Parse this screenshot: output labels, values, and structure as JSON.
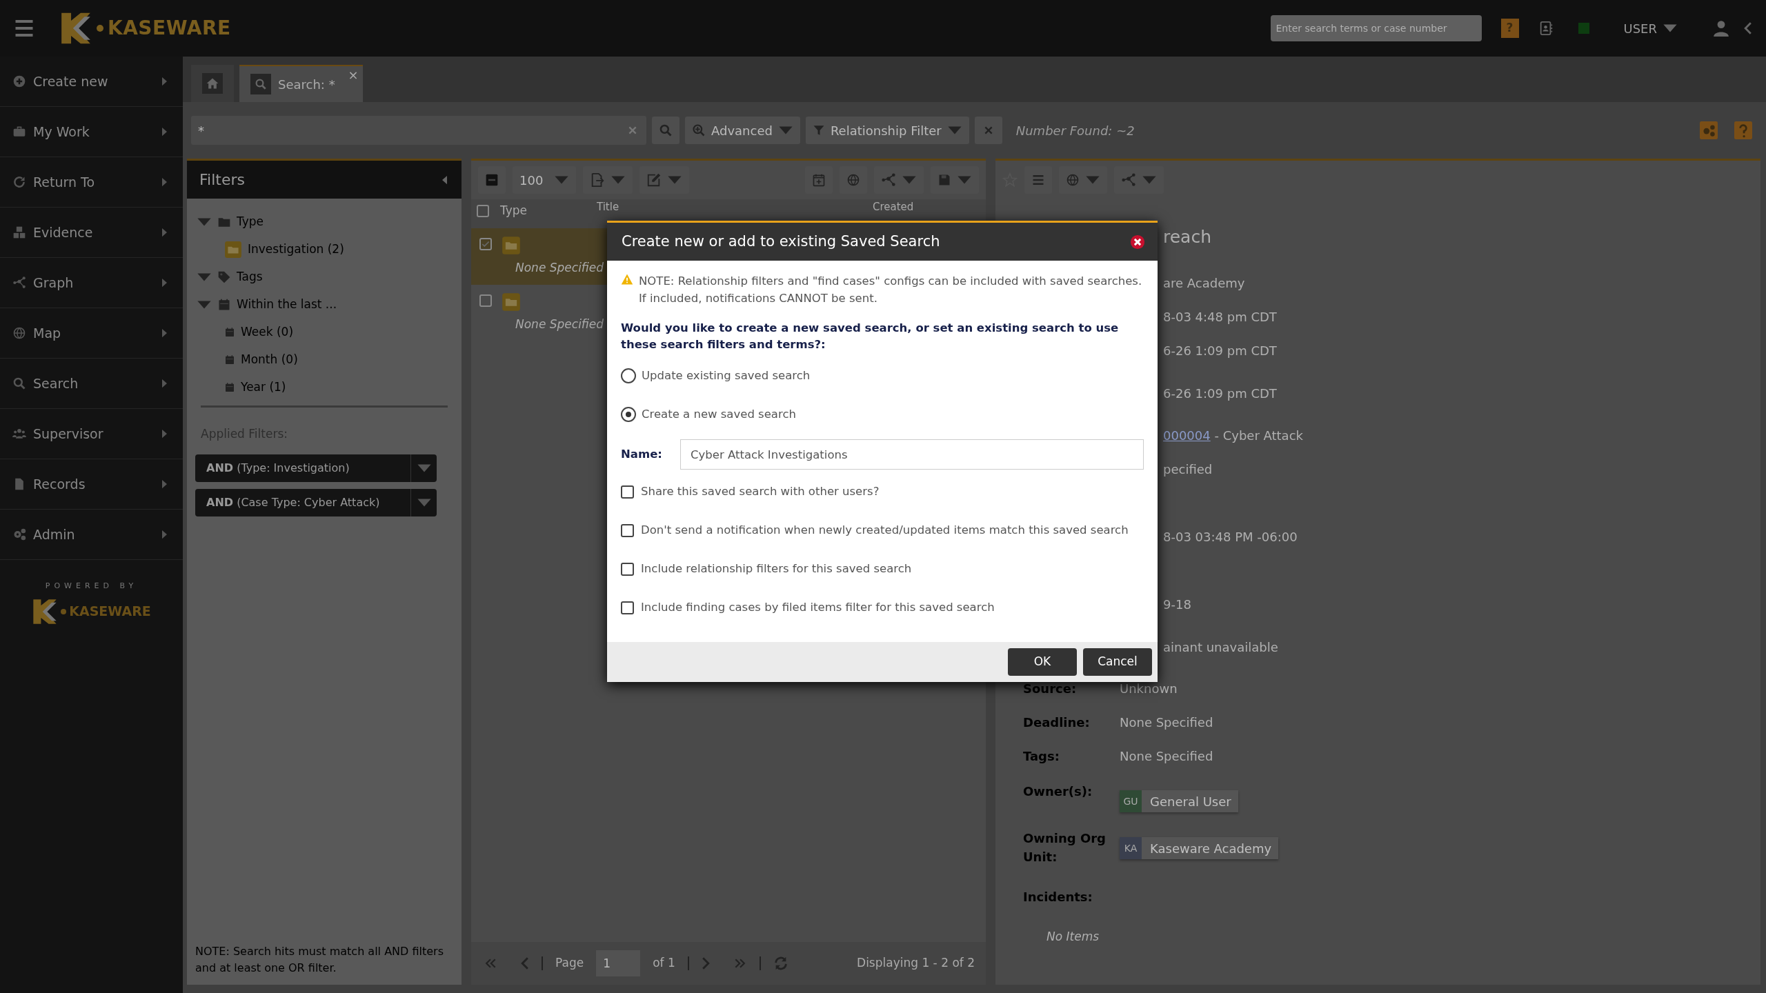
{
  "topbar": {
    "logo_text": "KASEWARE",
    "search": {
      "placeholder": "Enter search terms or case number"
    },
    "help": "?",
    "user": "USER"
  },
  "sidebar": {
    "items": [
      {
        "label": "Create new",
        "kind": "plus"
      },
      {
        "label": "My Work",
        "kind": "briefcase"
      },
      {
        "label": "Return To",
        "kind": "refresh"
      },
      {
        "label": "Evidence",
        "kind": "boxes"
      },
      {
        "label": "Graph",
        "kind": "graph"
      },
      {
        "label": "Map",
        "kind": "globe"
      },
      {
        "label": "Search",
        "kind": "search"
      },
      {
        "label": "Supervisor",
        "kind": "users"
      },
      {
        "label": "Records",
        "kind": "document"
      },
      {
        "label": "Admin",
        "kind": "gears"
      }
    ],
    "powered_by": "POWERED BY",
    "logo_text": "KASEWARE"
  },
  "tabs": [
    {
      "kind": "home",
      "selected": false
    },
    {
      "kind": "search",
      "label": "Search: *",
      "close": "×",
      "selected": true
    }
  ],
  "searchbar": {
    "query": "*",
    "advanced": "Advanced",
    "relationship_filter": "Relationship Filter",
    "number_found": "Number Found: ~2"
  },
  "filters": {
    "title": "Filters",
    "tree": [
      {
        "label": "Type",
        "kind": "folder",
        "expanded": true,
        "children": [
          {
            "label": "Investigation (2)",
            "kind": "case"
          }
        ]
      },
      {
        "label": "Tags",
        "kind": "tag",
        "expanded": true
      },
      {
        "label": "Within the last ...",
        "kind": "calendar",
        "expanded": true,
        "children": [
          {
            "label": "Week (0)",
            "kind": "calendar"
          },
          {
            "label": "Month (0)",
            "kind": "calendar"
          },
          {
            "label": "Year (1)",
            "kind": "calendar"
          }
        ]
      }
    ],
    "applied_label": "Applied Filters:",
    "applied": [
      "**AND** (Type: Investigation)",
      "**AND** (Case Type: Cyber Attack)"
    ],
    "note": "NOTE: Search hits must match all AND filters and at least one OR filter."
  },
  "results": {
    "page_size": "100",
    "select_all": {
      "checked": false
    },
    "columns": [
      "Type",
      "Title",
      "Created"
    ],
    "rows": [
      {
        "checked": true,
        "note": "None Specified"
      },
      {
        "checked": false,
        "note": "None Specified"
      }
    ],
    "pager": {
      "page_label": "Page",
      "page": "1",
      "of": "of 1",
      "displaying": "Displaying 1 - 2 of 2"
    }
  },
  "details": {
    "title": "reach",
    "rows": [
      {
        "value": "are Academy"
      },
      {
        "value": "8-03 4:48 pm CDT"
      },
      {
        "value": "6-26 1:09 pm CDT"
      },
      {
        "value": "6-26 1:09 pm CDT"
      },
      {
        "link": "000004",
        "value": " - Cyber Attack"
      },
      {
        "value": "pecified"
      },
      {
        "value": "8-03 03:48 PM -06:00"
      },
      {
        "value": "9-18"
      },
      {
        "value": "ainant unavailable"
      },
      {
        "label": "Source:",
        "value": "Unknown"
      },
      {
        "label": "Deadline:",
        "value": "None Specified"
      },
      {
        "label": "Tags:",
        "value": "None Specified"
      },
      {
        "label": "Owner(s):",
        "chip": {
          "initials": "GU",
          "text": "General User",
          "color": "#2f4a35"
        }
      },
      {
        "label": "Owning Org Unit:",
        "chip": {
          "initials": "KA",
          "text": "Kaseware Academy",
          "color": "#3a3f4e"
        }
      },
      {
        "label": "Incidents:"
      }
    ],
    "empty": "No Items"
  },
  "modal": {
    "title": "Create new or add to existing Saved Search",
    "note": "NOTE: Relationship filters and \"find cases\" configs can be included with saved searches. If included, notifications CANNOT be sent.",
    "question": "Would you like to create a new saved search, or set an existing search to use these search filters and terms?:",
    "options": [
      {
        "label": "Update existing saved search",
        "selected": false
      },
      {
        "label": "Create a new saved search",
        "selected": true
      }
    ],
    "name_label": "Name:",
    "name_value": "Cyber Attack Investigations",
    "checkboxes": [
      {
        "label": "Share this saved search with other users?",
        "checked": false
      },
      {
        "label": "Don't send a notification when newly created/updated items match this saved search",
        "checked": false
      },
      {
        "label": "Include relationship filters for this saved search",
        "checked": false
      },
      {
        "label": "Include finding cases by filed items filter for this saved search",
        "checked": false
      }
    ],
    "buttons": [
      "OK",
      "Cancel"
    ]
  }
}
